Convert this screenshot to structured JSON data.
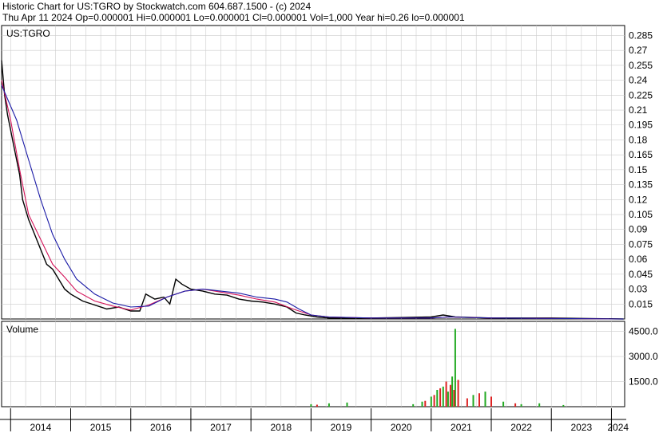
{
  "header": {
    "line1": "Historic Chart for US:TGRO by Stockwatch.com 604.687.1500 - (c) 2024",
    "line2": "Thu Apr 11 2024   Op=0.000001   Hi=0.000001   Lo=0.000001   Cl=0.000001   Vol=1,000   Year hi=0.26   lo=0.000001"
  },
  "colors": {
    "price": "#000000",
    "ma_short": "#d4145a",
    "ma_long": "#1a1aa6",
    "vol_up": "#22aa22",
    "vol_down": "#dd2222",
    "grid": "#cccccc"
  },
  "chart_data": [
    {
      "type": "line",
      "title": "US:TGRO",
      "y_ticks": [
        "0.285",
        "0.27",
        "0.255",
        "0.24",
        "0.225",
        "0.21",
        "0.195",
        "0.18",
        "0.165",
        "0.15",
        "0.135",
        "0.12",
        "0.105",
        "0.09",
        "0.075",
        "0.06",
        "0.045",
        "0.03",
        "0.015"
      ],
      "ylim": [
        0,
        0.295
      ],
      "grid": true,
      "x_ticks": [
        "2014",
        "2015",
        "2016",
        "2017",
        "2018",
        "2019",
        "2020",
        "2021",
        "2022",
        "2023",
        "2024"
      ],
      "xlim": [
        2013.85,
        2024.22
      ],
      "series": [
        {
          "role": "price",
          "x": [
            2013.85,
            2013.9,
            2013.95,
            2014.0,
            2014.05,
            2014.1,
            2014.15,
            2014.2,
            2014.3,
            2014.4,
            2014.5,
            2014.6,
            2014.7,
            2014.8,
            2014.9,
            2015.0,
            2015.2,
            2015.4,
            2015.6,
            2015.8,
            2016.0,
            2016.15,
            2016.25,
            2016.4,
            2016.55,
            2016.65,
            2016.75,
            2016.85,
            2017.0,
            2017.2,
            2017.4,
            2017.6,
            2017.8,
            2018.0,
            2018.2,
            2018.4,
            2018.6,
            2018.75,
            2018.9,
            2019.1,
            2019.3,
            2020.0,
            2021.0,
            2021.2,
            2021.4,
            2022.0,
            2023.0,
            2024.2
          ],
          "values": [
            0.26,
            0.225,
            0.205,
            0.19,
            0.175,
            0.16,
            0.145,
            0.12,
            0.1,
            0.085,
            0.07,
            0.055,
            0.05,
            0.04,
            0.03,
            0.025,
            0.018,
            0.014,
            0.01,
            0.012,
            0.008,
            0.008,
            0.025,
            0.02,
            0.022,
            0.015,
            0.04,
            0.035,
            0.03,
            0.028,
            0.025,
            0.024,
            0.02,
            0.018,
            0.017,
            0.015,
            0.012,
            0.006,
            0.004,
            0.002,
            0.001,
            0.001,
            0.002,
            0.004,
            0.002,
            0.001,
            0.001,
            1e-06
          ]
        },
        {
          "role": "ma_short",
          "x": [
            2013.85,
            2014.0,
            2014.15,
            2014.3,
            2014.5,
            2014.7,
            2014.9,
            2015.1,
            2015.4,
            2015.7,
            2016.0,
            2016.3,
            2016.6,
            2016.9,
            2017.2,
            2017.5,
            2017.8,
            2018.1,
            2018.4,
            2018.7,
            2019.0,
            2019.3,
            2020.0,
            2021.0,
            2021.3,
            2022.0,
            2024.2
          ],
          "values": [
            0.24,
            0.2,
            0.15,
            0.105,
            0.08,
            0.055,
            0.042,
            0.028,
            0.018,
            0.013,
            0.009,
            0.014,
            0.022,
            0.028,
            0.03,
            0.027,
            0.024,
            0.02,
            0.017,
            0.01,
            0.004,
            0.002,
            0.001,
            0.001,
            0.002,
            0.001,
            1e-06
          ]
        },
        {
          "role": "ma_long",
          "x": [
            2013.85,
            2014.1,
            2014.3,
            2014.5,
            2014.7,
            2014.9,
            2015.1,
            2015.4,
            2015.7,
            2016.0,
            2016.3,
            2016.6,
            2016.9,
            2017.2,
            2017.5,
            2017.8,
            2018.1,
            2018.4,
            2018.6,
            2018.8,
            2019.0,
            2019.3,
            2020.0,
            2021.0,
            2021.3,
            2022.0,
            2024.2
          ],
          "values": [
            0.235,
            0.2,
            0.16,
            0.12,
            0.085,
            0.06,
            0.04,
            0.025,
            0.016,
            0.012,
            0.013,
            0.022,
            0.028,
            0.03,
            0.028,
            0.026,
            0.022,
            0.02,
            0.017,
            0.01,
            0.004,
            0.002,
            0.001,
            0.001,
            0.002,
            0.001,
            1e-06
          ]
        }
      ]
    },
    {
      "type": "bar",
      "title": "Volume",
      "y_ticks": [
        "4500.0",
        "3000.0",
        "1500.0"
      ],
      "ylim": [
        0,
        5100
      ],
      "grid": true,
      "xlim": [
        2013.85,
        2024.22
      ],
      "series": [
        {
          "name": "up",
          "x": [
            2019.0,
            2019.3,
            2019.6,
            2020.7,
            2020.85,
            2021.0,
            2021.1,
            2021.2,
            2021.28,
            2021.35,
            2021.4,
            2021.7,
            2021.9,
            2022.2,
            2022.5,
            2022.8,
            2023.2
          ],
          "values": [
            150,
            200,
            250,
            150,
            300,
            600,
            1000,
            1200,
            900,
            1800,
            4650,
            700,
            900,
            300,
            150,
            200,
            100
          ]
        },
        {
          "name": "down",
          "x": [
            2019.1,
            2020.9,
            2021.05,
            2021.15,
            2021.25,
            2021.32,
            2021.38,
            2021.45,
            2021.6,
            2021.8,
            2022.0,
            2022.4
          ],
          "values": [
            120,
            350,
            700,
            1100,
            1500,
            1300,
            1000,
            1600,
            500,
            800,
            600,
            200
          ]
        }
      ]
    }
  ]
}
